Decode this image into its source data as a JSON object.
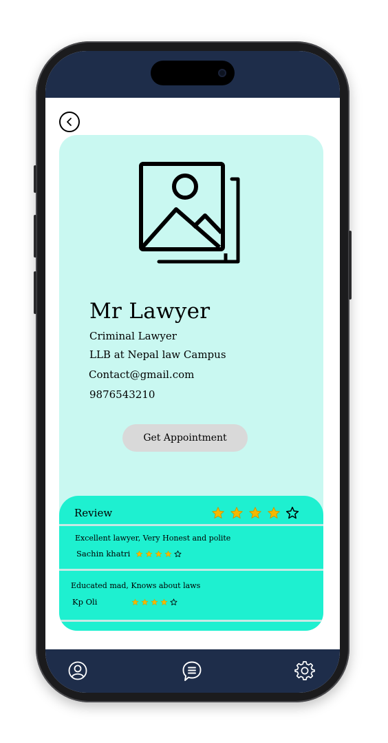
{
  "header": {
    "back_icon": "chevron-left-icon"
  },
  "profile": {
    "image_icon": "image-gallery-icon",
    "name": "Mr Lawyer",
    "specialty": "Criminal Lawyer",
    "education": "LLB at Nepal law Campus",
    "email": "Contact@gmail.com",
    "phone": "9876543210",
    "appointment_button": "Get Appointment"
  },
  "reviews": {
    "title": "Review",
    "overall_rating": 4,
    "max_rating": 5,
    "items": [
      {
        "text": "Excellent lawyer, Very Honest and polite",
        "reviewer": "Sachin khatri",
        "rating": 4
      },
      {
        "text": "Educated mad, Knows about laws",
        "reviewer": "Kp Oli",
        "rating": 4
      }
    ]
  },
  "bottom_nav": {
    "items": [
      {
        "icon": "user-profile-icon"
      },
      {
        "icon": "chat-icon"
      },
      {
        "icon": "gear-icon"
      }
    ]
  },
  "colors": {
    "status_bar": "#1e2d4a",
    "card_bg": "#c9f8f1",
    "review_bg": "#1ef0d0",
    "star_fill": "#f5b800"
  }
}
